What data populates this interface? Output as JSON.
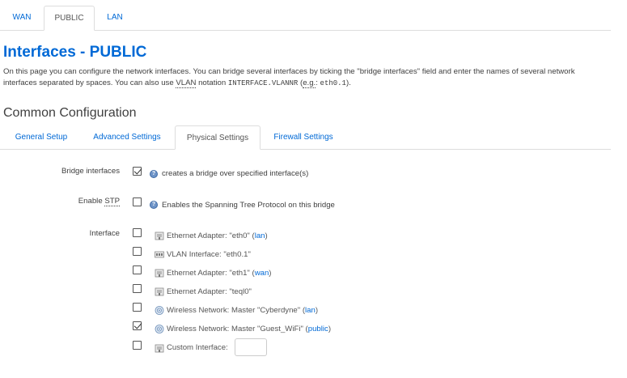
{
  "top_tabs": [
    {
      "label": "WAN"
    },
    {
      "label": "PUBLIC"
    },
    {
      "label": "LAN"
    }
  ],
  "page_title": "Interfaces - PUBLIC",
  "description": {
    "part1": "On this page you can configure the network interfaces. You can bridge several interfaces by ticking the \"bridge interfaces\" field and enter the names of several network interfaces separated by spaces. You can also use ",
    "vlan_abbr": "VLAN",
    "part2": " notation ",
    "code1": "INTERFACE.VLANNR",
    "part3": " (",
    "eg_abbr": "e.g.",
    "part4": ": ",
    "code2": "eth0.1",
    "part5": ")."
  },
  "section_title": "Common Configuration",
  "sub_tabs": [
    {
      "label": "General Setup"
    },
    {
      "label": "Advanced Settings"
    },
    {
      "label": "Physical Settings"
    },
    {
      "label": "Firewall Settings"
    }
  ],
  "bridge": {
    "label": "Bridge interfaces",
    "checked": true,
    "help": "creates a bridge over specified interface(s)"
  },
  "stp": {
    "label_prefix": "Enable ",
    "label_abbr": "STP",
    "checked": false,
    "help": "Enables the Spanning Tree Protocol on this bridge"
  },
  "interface": {
    "label": "Interface",
    "items": [
      {
        "text": "Ethernet Adapter: \"eth0\" (",
        "link": "lan",
        "suffix": ")",
        "checked": false,
        "icon": "ethernet-icon"
      },
      {
        "text": "VLAN Interface: \"eth0.1\"",
        "link": "",
        "suffix": "",
        "checked": false,
        "icon": "vlan-icon"
      },
      {
        "text": "Ethernet Adapter: \"eth1\" (",
        "link": "wan",
        "suffix": ")",
        "checked": false,
        "icon": "ethernet-icon"
      },
      {
        "text": "Ethernet Adapter: \"teql0\"",
        "link": "",
        "suffix": "",
        "checked": false,
        "icon": "ethernet-icon"
      },
      {
        "text": "Wireless Network: Master \"Cyberdyne\" (",
        "link": "lan",
        "suffix": ")",
        "checked": false,
        "icon": "wifi-icon"
      },
      {
        "text": "Wireless Network: Master \"Guest_WiFi\" (",
        "link": "public",
        "suffix": ")",
        "checked": true,
        "icon": "wifi-icon"
      }
    ],
    "custom_label": "Custom Interface:",
    "custom_value": ""
  },
  "help_icon_glyph": "?"
}
